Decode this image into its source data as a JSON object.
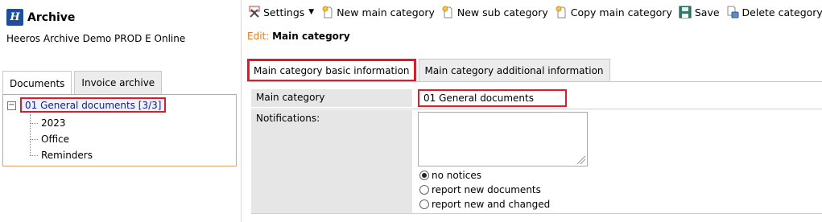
{
  "app": {
    "logo_letter": "H",
    "title": "Archive",
    "subtitle": "Heeros Archive Demo PROD E Online"
  },
  "left_tabs": [
    {
      "label": "Documents",
      "active": true
    },
    {
      "label": "Invoice archive",
      "active": false
    }
  ],
  "tree": {
    "toggle": "−",
    "root": "01 General documents [3/3]",
    "children": [
      "2023",
      "Office",
      "Reminders"
    ]
  },
  "toolbar": {
    "settings": "Settings",
    "new_main": "New main category",
    "new_sub": "New sub category",
    "copy_main": "Copy main category",
    "save": "Save",
    "delete": "Delete category"
  },
  "edit": {
    "label": "Edit:",
    "title": "Main category"
  },
  "right_tabs": [
    {
      "label": "Main category basic information",
      "active": true
    },
    {
      "label": "Main category additional information",
      "active": false
    }
  ],
  "form": {
    "main_category_label": "Main category",
    "main_category_value": "01 General documents",
    "notifications_label": "Notifications:",
    "notifications_value": "",
    "notice_options": [
      {
        "label": "no notices",
        "checked": true
      },
      {
        "label": "report new documents",
        "checked": false
      },
      {
        "label": "report new and changed",
        "checked": false
      }
    ]
  },
  "colors": {
    "brand": "#1d4f9a",
    "highlight": "#d81e2c",
    "edit_label": "#e07a20",
    "tree_border": "#e0a070"
  }
}
